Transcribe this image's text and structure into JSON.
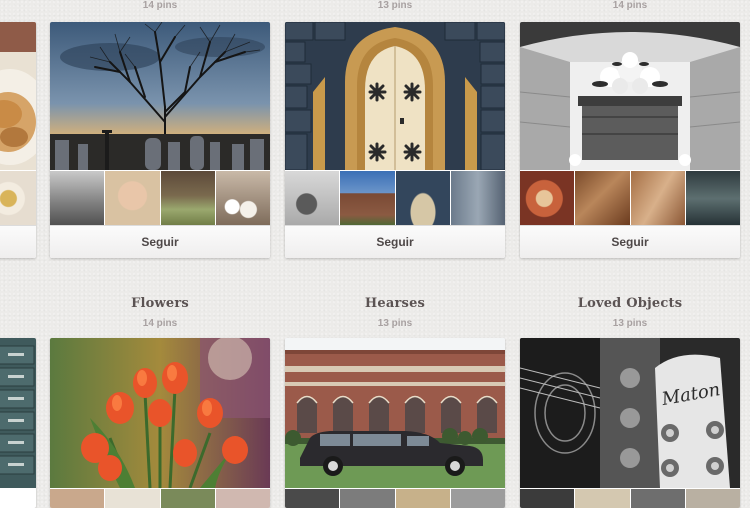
{
  "boards_top": [
    {
      "pins": "14 pins",
      "follow_label": "Seguir",
      "cover_icon": "cemetery-tree-photo",
      "thumbs": [
        "street-photo",
        "vintage-photo",
        "field-photo",
        "flowers-photo"
      ]
    },
    {
      "pins": "13 pins",
      "follow_label": "Seguir",
      "cover_icon": "gothic-door-photo",
      "thumbs": [
        "statue-photo",
        "church-photo",
        "arch-photo",
        "gravestone-photo"
      ]
    },
    {
      "pins": "14 pins",
      "follow_label": "Seguir",
      "cover_icon": "casket-photo",
      "thumbs": [
        "bouquet-photo",
        "wood-photo",
        "wood-detail-photo",
        "car-interior-photo"
      ]
    }
  ],
  "boards_bottom": [
    {
      "title": "Flowers",
      "pins": "14 pins",
      "cover_icon": "tulips-photo"
    },
    {
      "title": "Hearses",
      "pins": "13 pins",
      "cover_icon": "hearse-photo"
    },
    {
      "title": "Loved Objects",
      "pins": "13 pins",
      "cover_icon": "guitar-headstock-photo"
    }
  ],
  "guitar_brand": "Maton",
  "colors": {
    "background": "#ecebe9",
    "pin_count": "#a8a1a1",
    "title": "#5b5353",
    "button_text": "#4e4848"
  }
}
